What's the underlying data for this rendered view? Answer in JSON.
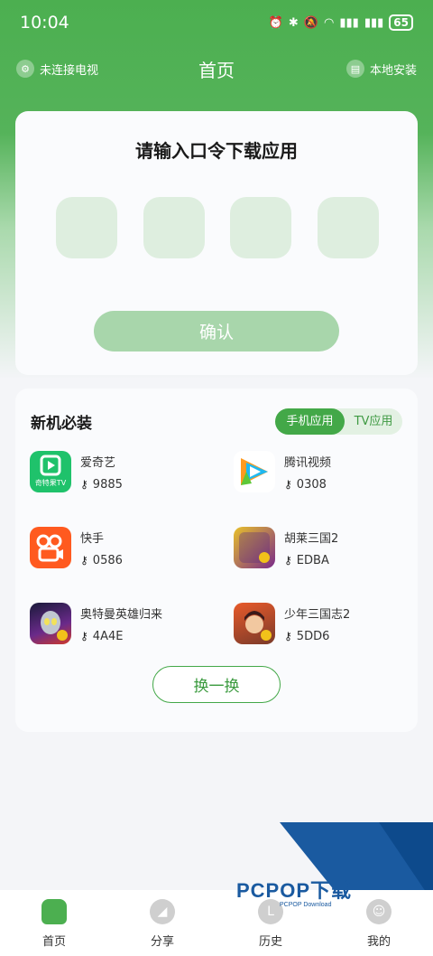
{
  "status": {
    "time": "10:04",
    "battery": "65"
  },
  "nav": {
    "left": "未连接电视",
    "title": "首页",
    "right": "本地安装"
  },
  "code_card": {
    "title": "请输入口令下载应用",
    "confirm": "确认"
  },
  "must": {
    "title": "新机必装",
    "tab_phone": "手机应用",
    "tab_tv": "TV应用",
    "apps": [
      {
        "name": "爱奇艺",
        "code": "9885",
        "icon": "iqiyi-icon",
        "color": "#2ecc71"
      },
      {
        "name": "腾讯视频",
        "code": "0308",
        "icon": "tencent-video-icon",
        "color": "#ffffff"
      },
      {
        "name": "快手",
        "code": "0586",
        "icon": "kuaishou-icon",
        "color": "#ff5a1f"
      },
      {
        "name": "胡莱三国2",
        "code": "EDBA",
        "icon": "hulai-icon",
        "color": "#7a2a8a"
      },
      {
        "name": "奥特曼英雄归来",
        "code": "4A4E",
        "icon": "ultraman-icon",
        "color": "#3a2a6a"
      },
      {
        "name": "少年三国志2",
        "code": "5DD6",
        "icon": "shaonian-icon",
        "color": "#b84a2a"
      }
    ],
    "swap": "换一换",
    "iqiyi_badge": "奇特果TV"
  },
  "tabs": [
    "首页",
    "分享",
    "历史",
    "我的"
  ],
  "watermark": {
    "brand": "PCPOP下载",
    "sub": "PCPOP Download"
  }
}
